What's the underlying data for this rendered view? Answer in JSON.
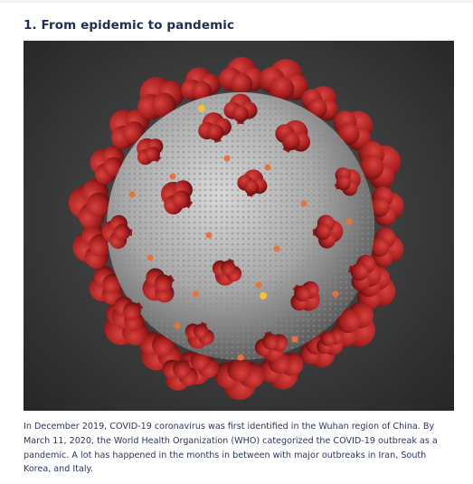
{
  "section": {
    "heading": "1. From epidemic to pandemic",
    "image": {
      "subject": "coronavirus-illustration",
      "colors": {
        "background": "#3b3b3b",
        "virion_surface": "#b9b9b9",
        "spikes": "#b5252a",
        "protein_orange": "#e8733a",
        "protein_yellow": "#f2c230"
      }
    },
    "caption": "In December 2019, COVID-19 coronavirus was first identified in the Wuhan region of China. By March 11, 2020, the World Health Organization (WHO) categorized the COVID-19 outbreak as a pandemic. A lot has happened in the months in between with major outbreaks in Iran, South Korea, and Italy."
  }
}
